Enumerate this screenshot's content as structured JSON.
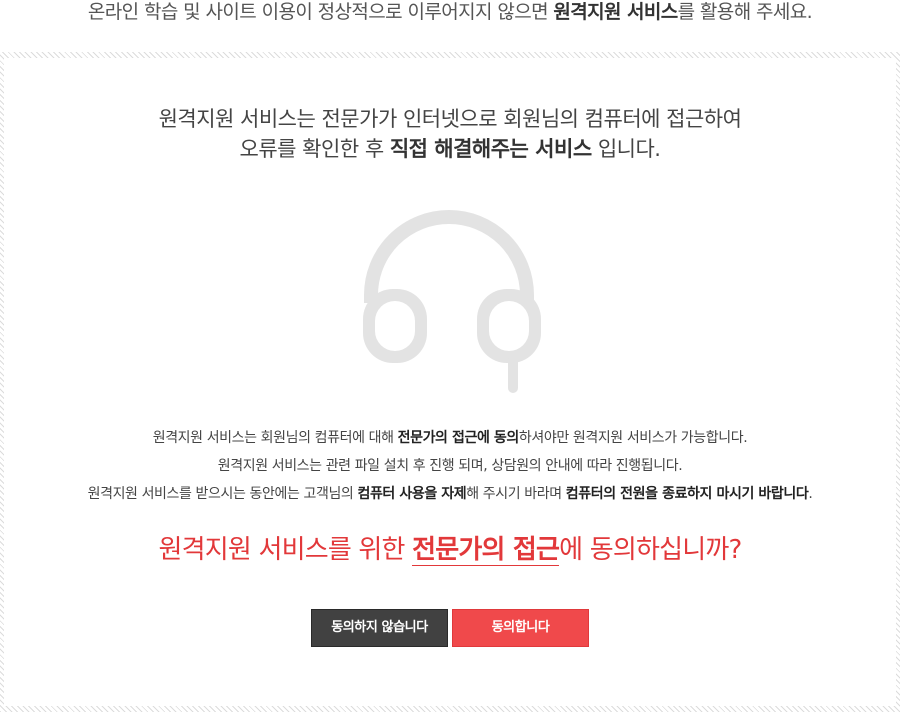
{
  "top_notice": {
    "text_before": "온라인 학습 및 사이트 이용이 정상적으로 이루어지지 않으면 ",
    "highlight": "원격지원 서비스",
    "text_after": "를 활용해 주세요."
  },
  "intro": {
    "line1": "원격지원 서비스는 전문가가 인터넷으로 회원님의 컴퓨터에 접근하여",
    "line2_before": "오류를 확인한 후 ",
    "line2_bold": "직접 해결해주는 서비스",
    "line2_after": " 입니다."
  },
  "icon": "headset-icon",
  "description": {
    "line1_before": "원격지원 서비스는 회원님의 컴퓨터에 대해 ",
    "line1_bold": "전문가의 접근에 동의",
    "line1_after": "하셔야만 원격지원 서비스가 가능합니다.",
    "line2": "원격지원 서비스는 관련 파일 설치 후 진행 되며, 상담원의 안내에 따라 진행됩니다.",
    "line3_before": "원격지원 서비스를 받으시는 동안에는 고객님의 ",
    "line3_bold1": "컴퓨터 사용을  자제",
    "line3_mid": "해 주시기 바라며 ",
    "line3_bold2": "컴퓨터의 전원을 종료하지 마시기 바랍니다",
    "line3_end": "."
  },
  "question": {
    "before": "원격지원 서비스를 위한 ",
    "bold": "전문가의 접근",
    "after": "에 동의하십니까?"
  },
  "buttons": {
    "decline": "동의하지 않습니다",
    "agree": "동의합니다"
  },
  "colors": {
    "accent_red": "#e2383a",
    "agree_button": "#f0494b",
    "decline_button": "#414141",
    "icon_gray": "#e3e3e3"
  }
}
